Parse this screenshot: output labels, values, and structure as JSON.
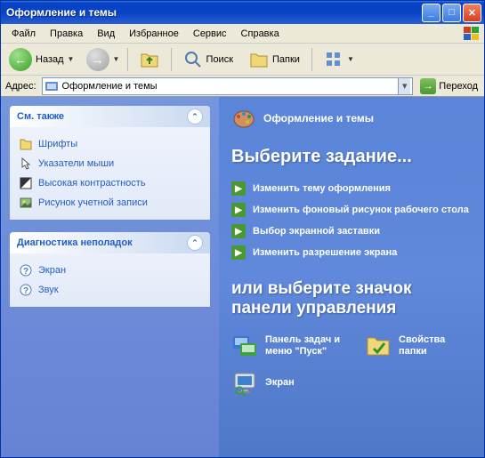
{
  "window": {
    "title": "Оформление и темы"
  },
  "menu": {
    "file": "Файл",
    "edit": "Правка",
    "view": "Вид",
    "favorites": "Избранное",
    "tools": "Сервис",
    "help": "Справка"
  },
  "toolbar": {
    "back": "Назад",
    "search": "Поиск",
    "folders": "Папки"
  },
  "address": {
    "label": "Адрес:",
    "value": "Оформление и темы",
    "go": "Переход"
  },
  "sidebar": {
    "see_also": {
      "title": "См. также",
      "items": [
        {
          "label": "Шрифты"
        },
        {
          "label": "Указатели мыши"
        },
        {
          "label": "Высокая контрастность"
        },
        {
          "label": "Рисунок учетной записи"
        }
      ]
    },
    "troubleshoot": {
      "title": "Диагностика неполадок",
      "items": [
        {
          "label": "Экран"
        },
        {
          "label": "Звук"
        }
      ]
    }
  },
  "main": {
    "category": "Оформление и темы",
    "pick_task": "Выберите задание...",
    "tasks": [
      "Изменить тему оформления",
      "Изменить фоновый рисунок рабочего стола",
      "Выбор экранной заставки",
      "Изменить разрешение экрана"
    ],
    "or_cp": "или выберите значок панели управления",
    "cp_items": [
      "Панель задач и меню \"Пуск\"",
      "Свойства папки",
      "Экран"
    ]
  }
}
